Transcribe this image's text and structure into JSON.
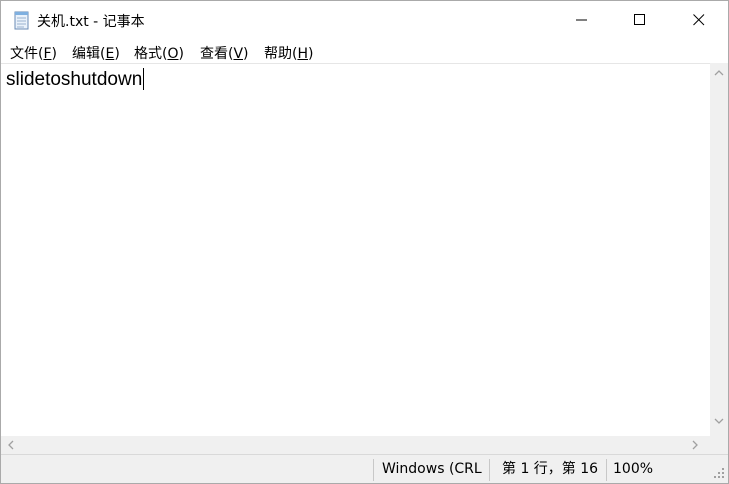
{
  "window": {
    "title": "关机.txt - 记事本"
  },
  "menu": {
    "items": [
      {
        "label": "文件(",
        "accel": "F",
        "suffix": ")"
      },
      {
        "label": "编辑(",
        "accel": "E",
        "suffix": ")"
      },
      {
        "label": "格式(",
        "accel": "O",
        "suffix": ")"
      },
      {
        "label": "查看(",
        "accel": "V",
        "suffix": ")"
      },
      {
        "label": "帮助(",
        "accel": "H",
        "suffix": ")"
      }
    ]
  },
  "editor": {
    "content": "slidetoshutdown"
  },
  "status": {
    "encoding": "Windows (CRL",
    "position": "第 1 行，第 16",
    "zoom": "100%"
  },
  "icons": {
    "app": "notepad-icon",
    "minimize": "minimize-icon",
    "maximize": "maximize-icon",
    "close": "close-icon"
  }
}
